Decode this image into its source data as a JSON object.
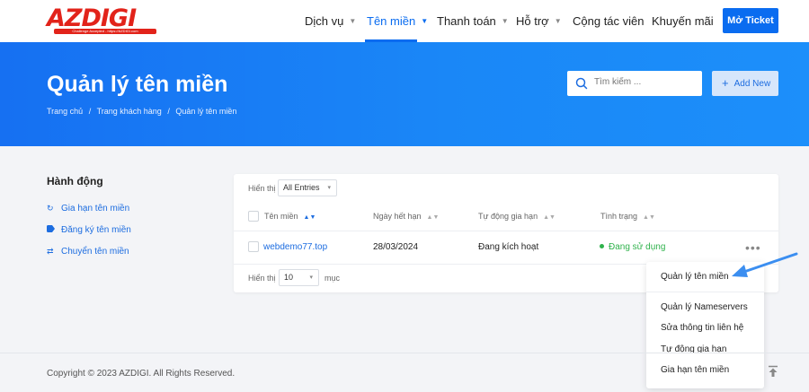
{
  "header": {
    "logo_text": "AZDIGI",
    "logo_tagline": "Challenge Accepted - https://AZDIGI.com",
    "nav": [
      {
        "label": "Dịch vụ",
        "has_caret": true,
        "active": false
      },
      {
        "label": "Tên miền",
        "has_caret": true,
        "active": true
      },
      {
        "label": "Thanh toán",
        "has_caret": true,
        "active": false
      },
      {
        "label": "Hỗ trợ",
        "has_caret": true,
        "active": false
      },
      {
        "label": "Cộng tác viên",
        "has_caret": false,
        "active": false
      },
      {
        "label": "Khuyến mãi",
        "has_caret": false,
        "active": false
      }
    ],
    "ticket_button": "Mở Ticket"
  },
  "hero": {
    "title": "Quản lý tên miền",
    "breadcrumb": [
      "Trang chủ",
      "/",
      "Trang khách hàng",
      "/",
      "Quản lý tên miền"
    ],
    "search_placeholder": "Tìm kiếm ...",
    "add_button": "Add New"
  },
  "sidebar": {
    "title": "Hành động",
    "items": [
      {
        "label": "Gia hạn tên miền",
        "icon": "refresh-icon"
      },
      {
        "label": "Đăng ký tên miền",
        "icon": "tag-icon"
      },
      {
        "label": "Chuyển tên miền",
        "icon": "transfer-icon"
      }
    ]
  },
  "table": {
    "show_label": "Hiển thị",
    "entries_select": "All Entries",
    "columns": [
      "Tên miền",
      "Ngày hết hạn",
      "Tự động gia hạn",
      "Tình trạng"
    ],
    "rows": [
      {
        "domain": "webdemo77.top",
        "expiry": "28/03/2024",
        "auto_renew": "Đang kích hoạt",
        "status": "Đang sử dụng"
      }
    ],
    "footer_show_label": "Hiển thị",
    "per_page": "10",
    "per_page_suffix": "mục"
  },
  "context_menu": {
    "items": [
      "Quản lý tên miền",
      "Quản lý Nameservers",
      "Sửa thông tin liên hệ",
      "Tự động gia hạn",
      "Gia hạn tên miền"
    ]
  },
  "footer": {
    "copyright": "Copyright © 2023 AZDIGI. All Rights Reserved."
  },
  "colors": {
    "primary": "#0a6cf0",
    "status_active": "#2fb24c",
    "logo_red": "#e2231a",
    "annotation_arrow": "#3b8ef0"
  }
}
